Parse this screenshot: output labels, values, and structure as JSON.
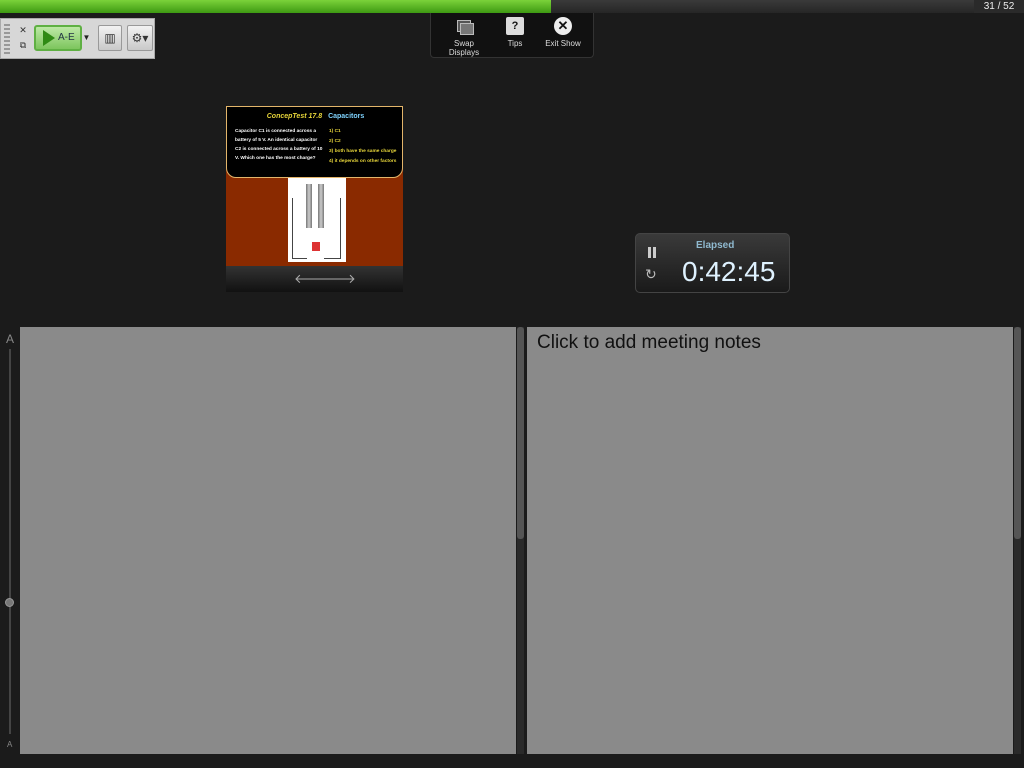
{
  "progress": {
    "current": 31,
    "total": 52,
    "fraction": 0.5655,
    "counter_text": "31 / 52"
  },
  "toolbar": {
    "poll_label": "A-E"
  },
  "top_panel": {
    "swap_label": "Swap Displays",
    "tips_label": "Tips",
    "tips_glyph": "?",
    "exit_label": "Exit Show",
    "exit_glyph": "✕"
  },
  "slide": {
    "title": "ConcepTest 17.8",
    "topic": "Capacitors",
    "question": "Capacitor C1 is connected across a battery of 5 V. An identical capacitor C2 is connected across a battery of 10 V. Which one has the most charge?",
    "answers": [
      "1) C1",
      "2) C2",
      "3) both have the same charge",
      "4) it depends on other factors"
    ],
    "prev_glyph": "🡐",
    "next_glyph": "🡒"
  },
  "timer": {
    "label": "Elapsed",
    "value": "0:42:45"
  },
  "notes": {
    "placeholder": "Click to add meeting notes"
  },
  "font_slider": {
    "large": "A",
    "small": "A"
  }
}
